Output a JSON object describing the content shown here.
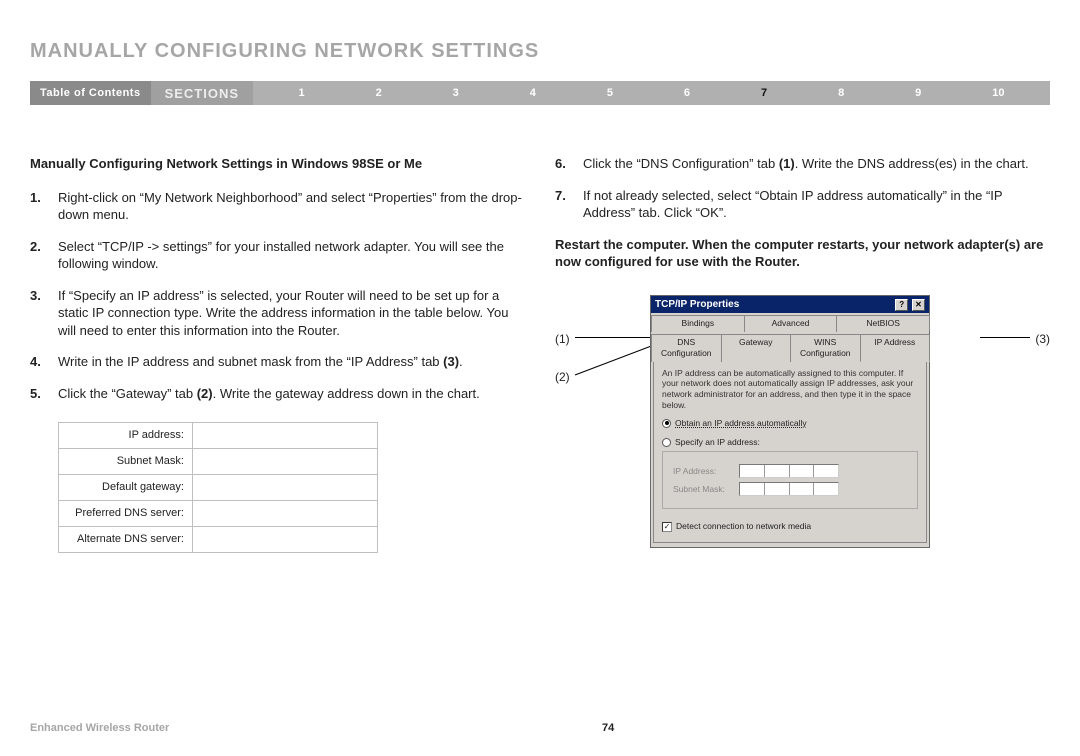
{
  "title": "MANUALLY CONFIGURING NETWORK SETTINGS",
  "nav": {
    "toc": "Table of Contents",
    "sections_label": "SECTIONS",
    "sections": [
      "1",
      "2",
      "3",
      "4",
      "5",
      "6",
      "7",
      "8",
      "9",
      "10"
    ],
    "active_section": "7"
  },
  "subhead": "Manually Configuring Network Settings in Windows 98SE or Me",
  "steps_left": [
    {
      "n": "1.",
      "text": "Right-click on “My Network Neighborhood” and select “Properties” from the drop-down menu."
    },
    {
      "n": "2.",
      "text": "Select “TCP/IP -> settings” for your installed network adapter. You will see the following window."
    },
    {
      "n": "3.",
      "text": "If “Specify an IP address” is selected, your Router will need to be set up for a static IP connection type. Write the address information in the table below. You will need to enter this information into the Router."
    },
    {
      "n": "4.",
      "pre": "Write in the IP address and subnet mask from the “IP Address” tab ",
      "bold": "(3)",
      "post": "."
    },
    {
      "n": "5.",
      "pre": "Click the “Gateway” tab ",
      "bold": "(2)",
      "post": ". Write the gateway address down in the chart."
    }
  ],
  "steps_right": [
    {
      "n": "6.",
      "pre": "Click the “DNS Configuration” tab ",
      "bold": "(1)",
      "post": ". Write the DNS address(es) in the chart."
    },
    {
      "n": "7.",
      "text": "If not already selected, select “Obtain IP address automatically” in the “IP Address” tab. Click “OK”."
    }
  ],
  "restart_note": "Restart the computer. When the computer restarts, your network adapter(s) are now configured for use with the Router.",
  "ip_table_rows": [
    "IP address:",
    "Subnet Mask:",
    "Default gateway:",
    "Preferred DNS server:",
    "Alternate DNS server:"
  ],
  "callouts": {
    "c1": "(1)",
    "c2": "(2)",
    "c3": "(3)"
  },
  "dialog": {
    "title": "TCP/IP Properties",
    "help_btn": "?",
    "close_btn": "✕",
    "tabs_row1": [
      "Bindings",
      "Advanced",
      "NetBIOS"
    ],
    "tabs_row2": [
      "DNS Configuration",
      "Gateway",
      "WINS Configuration",
      "IP Address"
    ],
    "active_tab": "IP Address",
    "body_text": "An IP address can be automatically assigned to this computer. If your network does not automatically assign IP addresses, ask your network administrator for an address, and then type it in the space below.",
    "radio_obtain": "Obtain an IP address automatically",
    "radio_specify": "Specify an IP address:",
    "field_ip": "IP Address:",
    "field_mask": "Subnet Mask:",
    "detect": "Detect connection to network media",
    "checked": "✓"
  },
  "footer": {
    "product": "Enhanced Wireless Router",
    "page": "74"
  }
}
